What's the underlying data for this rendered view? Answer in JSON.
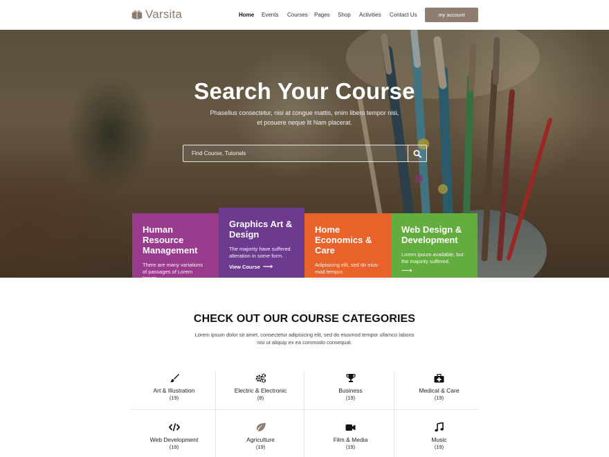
{
  "header": {
    "logo_text": "Varsita",
    "nav": [
      {
        "label": "Home",
        "active": true
      },
      {
        "label": "Events"
      },
      {
        "label": "Courses"
      },
      {
        "label": "Pages"
      },
      {
        "label": "Shop"
      },
      {
        "label": "Activities"
      },
      {
        "label": "Contact Us"
      }
    ],
    "account_button": "my account",
    "account_button_color": "#8e7e71"
  },
  "hero": {
    "title": "Search Your Course",
    "subtitle": "Phasellus consectetur, nisi at congue mattis, enim libero tempor nisi, et posuere neque lit Nam placerat.",
    "search_placeholder": "Find Course, Tutorials",
    "search_icon": "search-icon"
  },
  "courses": [
    {
      "title": "Human Resource Management",
      "desc": "There are many variations of passages of Lorem Ipsum.",
      "color": "#9a3a8c"
    },
    {
      "title": "Graphics Art & Design",
      "desc": "The majority have suffered alteration in some form.",
      "link": "View Course",
      "color": "#6c3a8e"
    },
    {
      "title": "Home Economics & Care",
      "desc": "Adipisicing elit, sed do eius-mod tempor.",
      "color": "#e8622a"
    },
    {
      "title": "Web Design & Development",
      "desc": "Lorem ipsum available, but the majority suffered.",
      "color": "#63ad3e"
    }
  ],
  "categories": {
    "title": "CHECK OUT OUR COURSE CATEGORIES",
    "subtitle": "Lorem ipsum dolor sit amet, consectetur adipisicing elit, sed do eiusmod tempor ullamco laboris nisi ut aliquip ex ea commodo consequat.",
    "items": [
      {
        "name": "Art & Illustration",
        "count": "(19)",
        "icon": "paint-brush-icon"
      },
      {
        "name": "Electric & Electronic",
        "count": "(8)",
        "icon": "cogs-icon"
      },
      {
        "name": "Business",
        "count": "(19)",
        "icon": "trophy-icon"
      },
      {
        "name": "Medical & Care",
        "count": "(19)",
        "icon": "medical-kit-icon"
      },
      {
        "name": "Web Development",
        "count": "(19)",
        "icon": "code-icon"
      },
      {
        "name": "Agriculture",
        "count": "(19)",
        "icon": "leaf-icon"
      },
      {
        "name": "Film & Media",
        "count": "(19)",
        "icon": "video-camera-icon"
      },
      {
        "name": "Music",
        "count": "(19)",
        "icon": "music-note-icon"
      }
    ]
  }
}
